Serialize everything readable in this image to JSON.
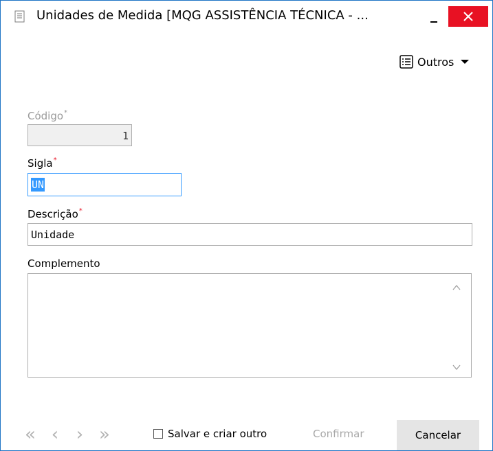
{
  "window": {
    "title": "Unidades de Medida [MQG ASSISTÊNCIA TÉCNICA - ..."
  },
  "toolbar": {
    "outros_label": "Outros"
  },
  "form": {
    "codigo": {
      "label": "Código",
      "required_mark": "*",
      "value": "1"
    },
    "sigla": {
      "label": "Sigla",
      "required_mark": "*",
      "value": "UN"
    },
    "descricao": {
      "label": "Descrição",
      "required_mark": "*",
      "value": "Unidade"
    },
    "complemento": {
      "label": "Complemento",
      "value": ""
    }
  },
  "footer": {
    "nav": [
      "«",
      "‹",
      "›",
      "»"
    ],
    "save_and_create_label": "Salvar e criar outro",
    "save_and_create_checked": false,
    "confirm_label": "Confirmar",
    "cancel_label": "Cancelar"
  },
  "icons": {
    "app": "document-icon",
    "outros": "list-icon",
    "minimize": "minimize-icon",
    "close": "close-icon"
  },
  "colors": {
    "close_button": "#e81123",
    "required_asterisk": "#e81123",
    "focus_border": "#3399ff",
    "window_border": "#1c73c5",
    "cancel_button": "#e5e5e5"
  }
}
